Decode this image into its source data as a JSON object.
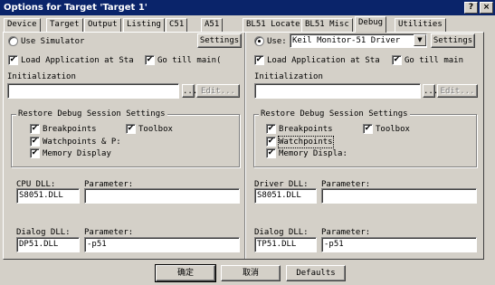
{
  "window": {
    "title": "Options for Target 'Target 1'",
    "help_glyph": "?",
    "close_glyph": "×"
  },
  "tabs": [
    {
      "label": "Device"
    },
    {
      "label": "Target"
    },
    {
      "label": "Output"
    },
    {
      "label": "Listing"
    },
    {
      "label": "C51"
    },
    {
      "label": "A51"
    },
    {
      "label": "BL51 Locate"
    },
    {
      "label": "BL51 Misc"
    },
    {
      "label": "Debug"
    },
    {
      "label": "Utilities"
    }
  ],
  "left": {
    "mode_label": "Use Simulator",
    "settings_label": "Settings",
    "load_app_label": "Load Application at Sta",
    "go_label": "Go  till main(",
    "init_label": "Initialization",
    "init_value": "",
    "browse_label": "...",
    "edit_label": "Edit...",
    "restore_title": "Restore Debug Session Settings",
    "breakpoints_label": "Breakpoints",
    "toolbox_label": "Toolbox",
    "watchpoints_label": "Watchpoints & P:",
    "memory_label": "Memory Display",
    "cpu_dll_label": "CPU DLL:",
    "cpu_dll_value": "S8051.DLL",
    "cpu_param_label": "Parameter:",
    "cpu_param_value": "",
    "dialog_dll_label": "Dialog DLL:",
    "dialog_dll_value": "DP51.DLL",
    "dialog_param_label": "Parameter:",
    "dialog_param_value": "-p51"
  },
  "right": {
    "mode_label": "Use:",
    "driver_value": "Keil Monitor-51 Driver",
    "settings_label": "Settings",
    "load_app_label": "Load Application at Sta",
    "go_label": "Go  till main",
    "init_label": "Initialization",
    "init_value": "",
    "browse_label": "...",
    "edit_label": "Edit...",
    "restore_title": "Restore Debug Session Settings",
    "breakpoints_label": "Breakpoints",
    "toolbox_label": "Toolbox",
    "watchpoints_label": "Watchpoints",
    "memory_label": "Memory Displa:",
    "driver_dll_label": "Driver DLL:",
    "driver_dll_value": "S8051.DLL",
    "driver_param_label": "Parameter:",
    "driver_param_value": "",
    "dialog_dll_label": "Dialog DLL:",
    "dialog_dll_value": "TP51.DLL",
    "dialog_param_label": "Parameter:",
    "dialog_param_value": "-p51"
  },
  "footer": {
    "ok_label": "确定",
    "cancel_label": "取消",
    "defaults_label": "Defaults"
  },
  "check_glyph": "✔",
  "dropdown_glyph": "▼"
}
